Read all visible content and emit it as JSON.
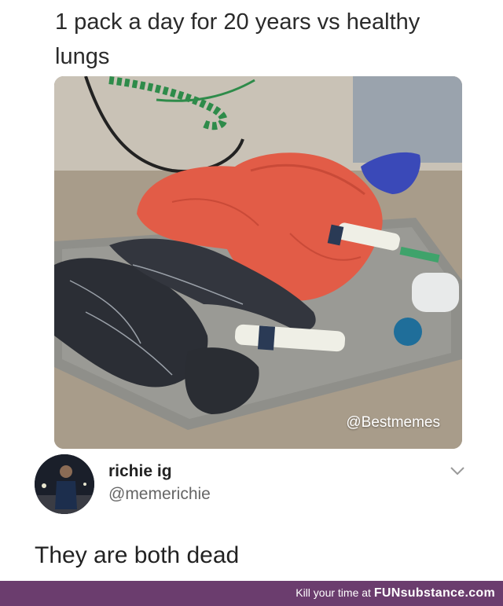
{
  "caption": "1 pack a day for 20 years vs healthy lungs",
  "photo": {
    "watermark": "@Bestmemes"
  },
  "tweet": {
    "display_name": "richie ig",
    "handle": "@memerichie",
    "text": "They are both dead"
  },
  "footer": {
    "prefix": "Kill your time at ",
    "brand": "FUNsubstance.com"
  },
  "colors": {
    "footer_bg": "#6b3d6e",
    "healthy_lung": "#e8604c",
    "smoker_lung": "#2a2d33"
  },
  "icons": [
    "chevron-down-icon"
  ]
}
